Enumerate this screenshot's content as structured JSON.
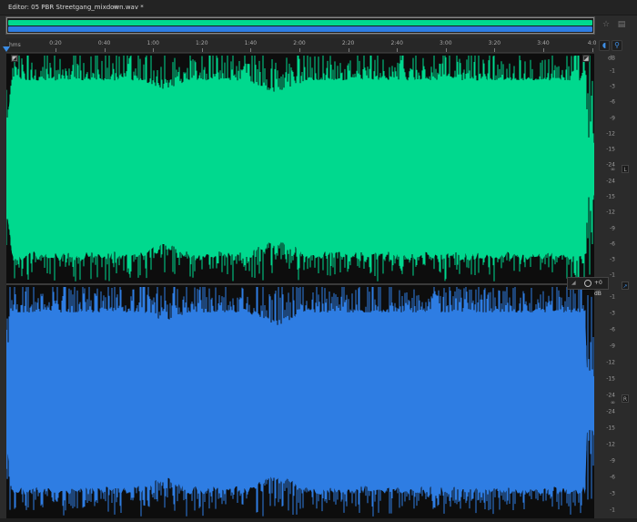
{
  "editor": {
    "title": "Editor: 05 PBR Streetgang_mixdown.wav *",
    "menu_icon": "≡"
  },
  "overview": {
    "colors": {
      "left": "#00d98e",
      "right": "#2e7de3"
    },
    "zoom_in_icon": "zoom-in-icon",
    "zoom_out_icon": "zoom-out-icon",
    "zoom_in_glyph": "☆",
    "zoom_out_glyph": "▤"
  },
  "ruler": {
    "unit": "hms",
    "ticks": [
      "0:20",
      "0:40",
      "1:00",
      "1:20",
      "1:40",
      "2:00",
      "2:20",
      "2:40",
      "3:00",
      "3:20",
      "3:40",
      "4:0"
    ]
  },
  "db_scale": {
    "header": "dB",
    "left": [
      "-1",
      "-3",
      "-6",
      "-9",
      "-12",
      "-15",
      "-24",
      "-24",
      "-15",
      "-12",
      "-9",
      "-6",
      "-3",
      "-1"
    ],
    "right": [
      "-1",
      "-3",
      "-6",
      "-9",
      "-12",
      "-15",
      "-24",
      "-24",
      "-15",
      "-12",
      "-9",
      "-6",
      "-3",
      "-1"
    ],
    "inf": "∞"
  },
  "channels": {
    "left_tag": "L",
    "right_tag": "R"
  },
  "hud": {
    "volume": "+0 dB"
  },
  "waveform": {
    "left_color": "#00d98e",
    "right_color": "#2e7de3",
    "background": "#0d0d0d"
  }
}
